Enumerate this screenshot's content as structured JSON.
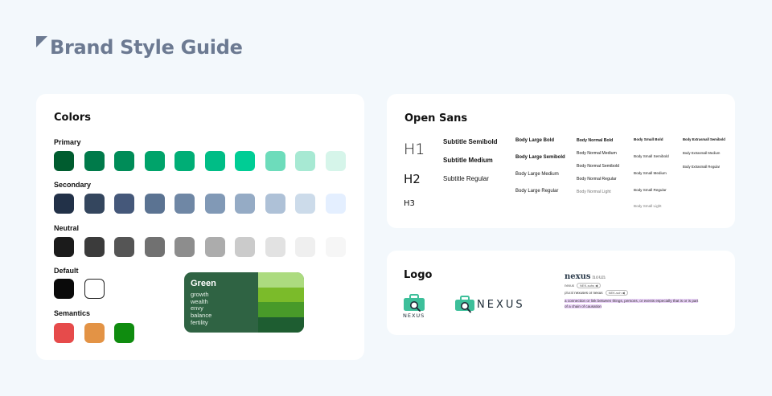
{
  "page_title": "Brand Style Guide",
  "colors": {
    "title": "Colors",
    "groups": [
      {
        "label": "Primary",
        "swatches": [
          "#005c2f",
          "#007a4a",
          "#008c58",
          "#00a36a",
          "#00ae76",
          "#00bd86",
          "#00cd95",
          "#6ddcbb",
          "#a7e9d3",
          "#d6f5ea"
        ]
      },
      {
        "label": "Secondary",
        "swatches": [
          "#223148",
          "#34465e",
          "#45587a",
          "#5b7392",
          "#6f87a5",
          "#8199b6",
          "#95abc5",
          "#aec1d7",
          "#ccdbea",
          "#e4efff"
        ]
      },
      {
        "label": "Neutral",
        "swatches": [
          "#1b1b1b",
          "#3b3b3b",
          "#555555",
          "#717171",
          "#8d8d8d",
          "#acacac",
          "#cbcbcb",
          "#e2e2e2",
          "#efefef",
          "#f6f6f6"
        ]
      },
      {
        "label": "Default",
        "swatches": [
          "#0a0a0a",
          "#ffffff"
        ]
      },
      {
        "label": "Semantics",
        "swatches": [
          "#e64b4b",
          "#e39345",
          "#0f8c0f"
        ]
      }
    ],
    "green_card": {
      "title": "Green",
      "words": [
        "growth",
        "wealth",
        "envy",
        "balance",
        "fertility"
      ],
      "bg": "#2f6343",
      "stripes": [
        "#acdb7f",
        "#7bbb2a",
        "#489a29",
        "#1e5d31"
      ]
    }
  },
  "typography": {
    "title": "Open Sans",
    "headings": [
      "H1",
      "H2",
      "H3"
    ],
    "subtitles": [
      "Subtitle Semibold",
      "Subtitle Medium",
      "Subtitle Regular"
    ],
    "body_large": [
      "Body Large Bold",
      "Body Large Semibold",
      "Body Large Medium",
      "Body Large Regular"
    ],
    "body_normal": [
      "Body Normal Bold",
      "Body Normal Medium",
      "Body Normal Semibold",
      "Body Normal Regular",
      "Body Normal Light"
    ],
    "body_small": [
      "Body Small Bold",
      "Body Small Semibold",
      "Body Small Medium",
      "Body Small Regular",
      "Body Small Light"
    ],
    "body_extrasmall": [
      "Body Extrasmall Semibold",
      "Body Extrasmall Medium",
      "Body Extrasmall Regular"
    ]
  },
  "logo": {
    "title": "Logo",
    "wordmark_small": "NEXUS",
    "wordmark_large": "NEXUS",
    "icon_color": "#3dbf9a",
    "dictionary": {
      "word": "nexus",
      "pos": "noun",
      "line1_label": "nexus",
      "line1_pill": "NEK-suhs ◀",
      "line2_prefix": "plural",
      "line2_forms": "nexuses or nexus",
      "line2_pill": "NEK-suh ◀",
      "definition": "a connection or link between things, persons, or events especially that is or is part of a chain of causation"
    }
  }
}
